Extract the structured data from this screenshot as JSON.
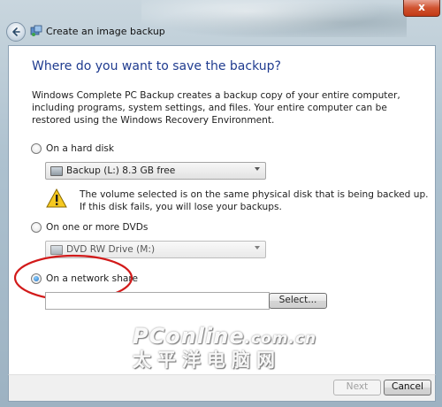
{
  "window": {
    "title": "Create an image backup",
    "close_glyph": "x"
  },
  "page": {
    "heading": "Where do you want to save the backup?",
    "description": "Windows Complete PC Backup creates a backup copy of your entire computer, including programs, system settings, and files. Your entire computer can be restored using the Windows Recovery Environment."
  },
  "options": {
    "hard_disk": {
      "label": "On a hard disk",
      "checked": false,
      "selected_drive": "Backup (L:)  8.3 GB free"
    },
    "warning": "The volume selected is on the same physical disk that is being backed up. If this disk fails, you will lose your backups.",
    "dvd": {
      "label": "On one or more DVDs",
      "checked": false,
      "selected_drive": "DVD RW Drive (M:)"
    },
    "network": {
      "label": "On a network share",
      "checked": true,
      "path_value": "",
      "select_button": "Select..."
    }
  },
  "footer": {
    "next_label": "Next",
    "cancel_label": "Cancel"
  },
  "watermark": {
    "line1_main": "PConline",
    "line1_suffix": ".com.cn",
    "line2": "太平洋电脑网"
  },
  "colors": {
    "heading": "#1f3b8f",
    "highlight_ellipse": "#d21a1a",
    "close_button": "#c23a16"
  },
  "icons": {
    "back": "back-arrow-icon",
    "app": "backup-app-icon",
    "drive": "drive-icon",
    "warning": "warning-icon"
  }
}
